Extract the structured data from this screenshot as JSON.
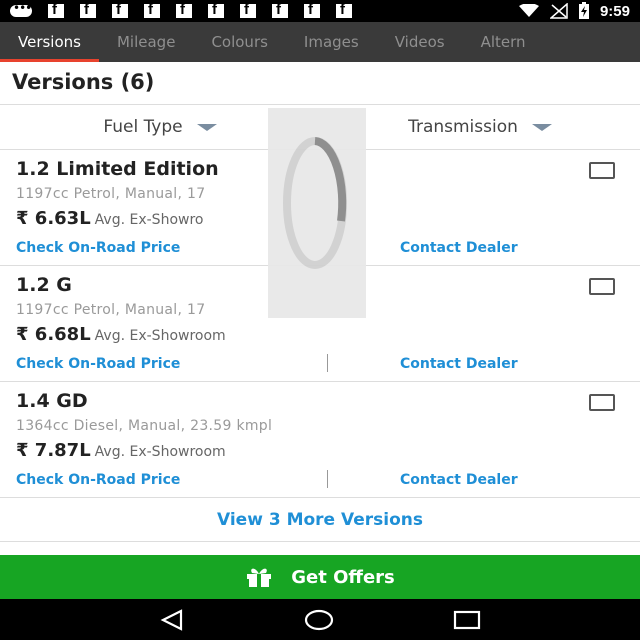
{
  "status_bar": {
    "time": "9:59"
  },
  "tabs": [
    {
      "label": "Versions"
    },
    {
      "label": "Mileage"
    },
    {
      "label": "Colours"
    },
    {
      "label": "Images"
    },
    {
      "label": "Videos"
    },
    {
      "label": "Altern"
    }
  ],
  "header": {
    "title": "Versions (6)"
  },
  "filters": {
    "fuel_type": "Fuel Type",
    "transmission": "Transmission"
  },
  "versions": [
    {
      "name": "1.2 Limited Edition",
      "spec": "1197cc Petrol, Manual, 17",
      "price": "₹ 6.63L",
      "price_sub": "Avg. Ex-Showro",
      "onroad": "Check On-Road Price",
      "dealer": "Contact Dealer"
    },
    {
      "name": "1.2 G",
      "spec": "1197cc Petrol, Manual, 17",
      "price": "₹ 6.68L",
      "price_sub": "Avg. Ex-Showroom",
      "onroad": "Check On-Road Price",
      "dealer": "Contact Dealer"
    },
    {
      "name": "1.4 GD",
      "spec": "1364cc Diesel, Manual, 23.59 kmpl",
      "price": "₹ 7.87L",
      "price_sub": "Avg. Ex-Showroom",
      "onroad": "Check On-Road Price",
      "dealer": "Contact Dealer"
    }
  ],
  "view_more": "View 3 More Versions",
  "offers": {
    "label": "Get Offers"
  },
  "colors": {
    "tab_bg": "#3a3a3a",
    "accent": "#e8432e",
    "link": "#1f8fd6",
    "offers_bg": "#17a523"
  }
}
